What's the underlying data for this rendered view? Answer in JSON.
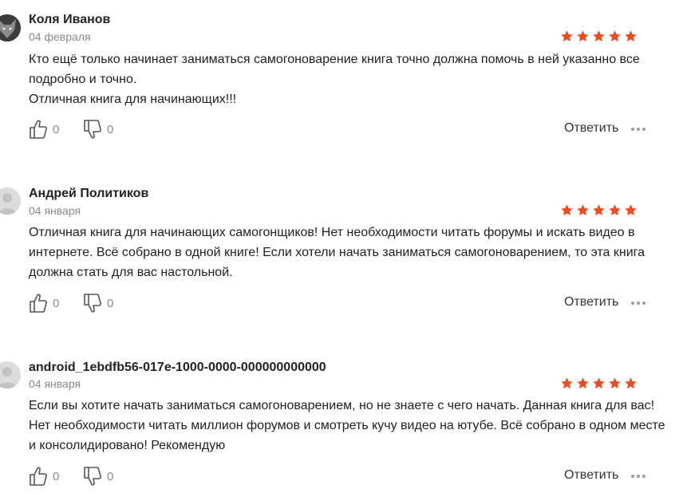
{
  "reviews": [
    {
      "author": "Коля Иванов",
      "date": "04 февраля",
      "rating": 5,
      "avatar": "wolf-avatar",
      "paragraphs": [
        "Кто ещё только начинает заниматься самогоноварение книга точно должна помочь в ней указанно все подробно и точно.",
        "Отличная книга для начинающих!!!"
      ],
      "likes": "0",
      "dislikes": "0",
      "reply_label": "Ответить"
    },
    {
      "author": "Андрей Политиков",
      "date": "04 января",
      "rating": 5,
      "avatar": "default-avatar",
      "paragraphs": [
        "Отличная книга для начинающих самогонщиков! Нет необходимости читать форумы и искать видео в интернете. Всё собрано в одной книге! Если хотели начать заниматься самогоноварением, то эта книга должна стать для вас настольной."
      ],
      "likes": "0",
      "dislikes": "0",
      "reply_label": "Ответить"
    },
    {
      "author": "android_1ebdfb56-017e-1000-0000-000000000000",
      "date": "04 января",
      "rating": 5,
      "avatar": "default-avatar",
      "paragraphs": [
        "Если вы хотите начать заниматься самогоноварением, но не знаете с чего начать. Данная книга для вас! Нет необходимости читать миллион форумов и смотреть кучу видео на ютубе. Всё собрано в одном месте и консолидировано! Рекомендую"
      ],
      "likes": "0",
      "dislikes": "0",
      "reply_label": "Ответить"
    }
  ],
  "colors": {
    "star": "#ee4d1f",
    "muted": "#8a8a8a"
  },
  "icons": {
    "like": "thumbs-up-icon",
    "dislike": "thumbs-down-icon",
    "more": "more-dots-icon",
    "star": "star-icon"
  }
}
